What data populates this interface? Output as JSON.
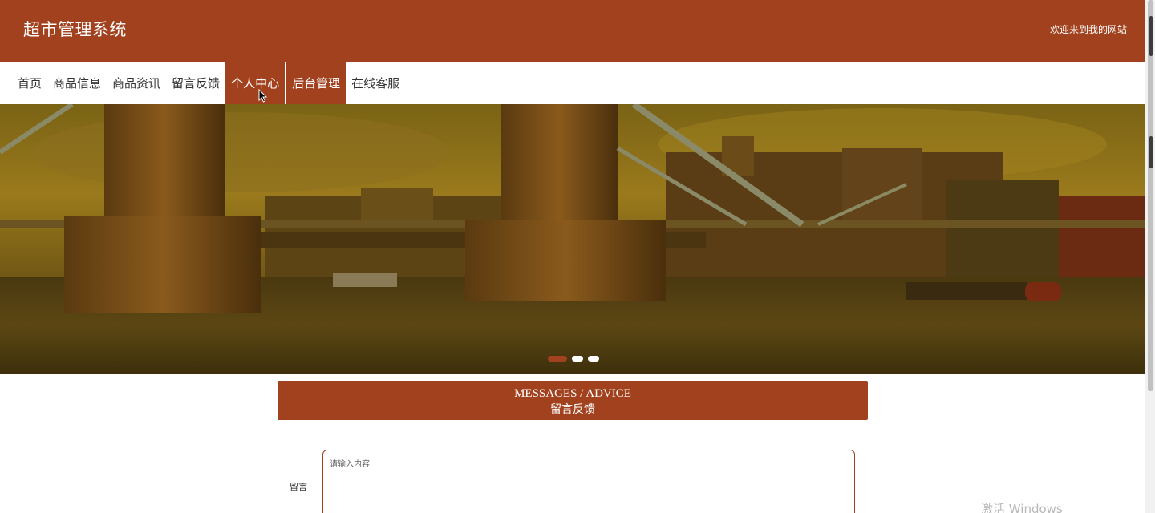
{
  "header": {
    "title": "超市管理系统",
    "welcome": "欢迎来到我的网站"
  },
  "nav": {
    "items": [
      {
        "label": "首页"
      },
      {
        "label": "商品信息"
      },
      {
        "label": "商品资讯"
      },
      {
        "label": "留言反馈"
      },
      {
        "label": "个人中心"
      },
      {
        "label": "后台管理"
      },
      {
        "label": "在线客服"
      }
    ]
  },
  "banner": {
    "carousel_slides": 3,
    "active_slide": 1
  },
  "messages": {
    "title_en": "MESSAGES / ADVICE",
    "title_cn": "留言反馈",
    "field_label": "留言",
    "placeholder": "请输入内容"
  },
  "watermark": "激活 Windows",
  "colors": {
    "brand": "#a1411e",
    "background": "#ffffff"
  }
}
